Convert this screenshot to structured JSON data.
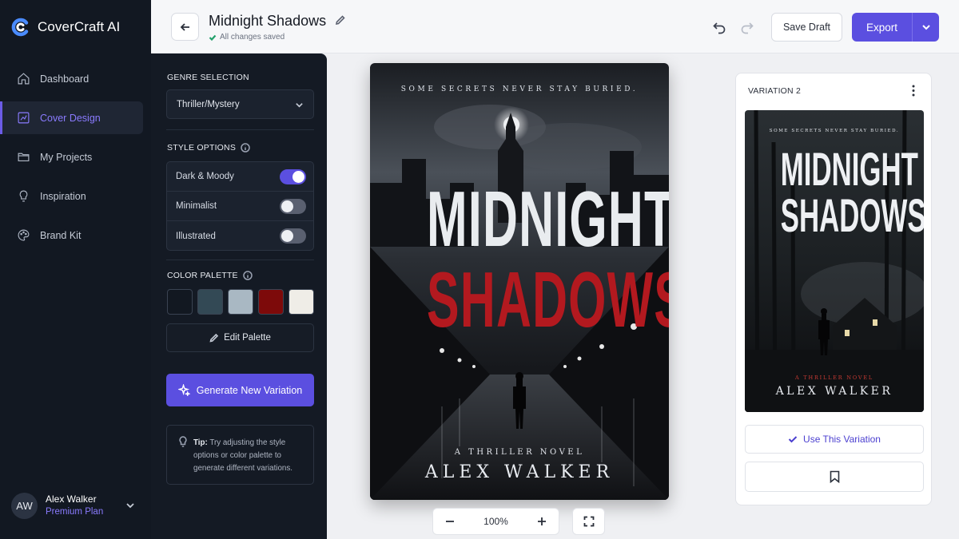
{
  "app": {
    "name": "CoverCraft AI"
  },
  "sidebar": {
    "items": [
      {
        "label": "Dashboard",
        "icon": "home-icon"
      },
      {
        "label": "Cover Design",
        "icon": "design-icon",
        "active": true
      },
      {
        "label": "My Projects",
        "icon": "folder-icon"
      },
      {
        "label": "Inspiration",
        "icon": "lightbulb-icon"
      },
      {
        "label": "Brand Kit",
        "icon": "palette-icon"
      }
    ],
    "user": {
      "initials": "AW",
      "name": "Alex Walker",
      "plan": "Premium Plan"
    }
  },
  "header": {
    "title": "Midnight Shadows",
    "status": "All changes saved",
    "save_draft": "Save Draft",
    "export": "Export"
  },
  "panel": {
    "genre_label": "GENRE SELECTION",
    "genre_value": "Thriller/Mystery",
    "style_label": "STYLE OPTIONS",
    "styles": [
      {
        "label": "Dark & Moody",
        "on": true
      },
      {
        "label": "Minimalist",
        "on": false
      },
      {
        "label": "Illustrated",
        "on": false
      }
    ],
    "palette_label": "COLOR PALETTE",
    "palette": [
      "#121821",
      "#334955",
      "#a9b8c3",
      "#7d0a0a",
      "#efede7"
    ],
    "edit_palette": "Edit Palette",
    "generate": "Generate New Variation",
    "tip_bold": "Tip:",
    "tip_text": " Try adjusting the style options or color palette to generate different variations."
  },
  "cover": {
    "tagline": "SOME SECRETS NEVER STAY BURIED.",
    "title_line1": "MIDNIGHT",
    "title_line2": "SHADOWS",
    "subtitle": "A THRILLER NOVEL",
    "author": "ALEX WALKER",
    "title_color_1": "#e9ecef",
    "title_color_2": "#b3191f"
  },
  "zoom": {
    "level": "100%"
  },
  "variation": {
    "label": "VARIATION 2",
    "tagline": "SOME SECRETS NEVER STAY BURIED.",
    "title_line1": "MIDNIGHT",
    "title_line2": "SHADOWS",
    "subtitle": "A THRILLER NOVEL",
    "author": "ALEX WALKER",
    "use_label": "Use This Variation"
  },
  "colors": {
    "accent": "#5b4fe0",
    "sidebar_bg": "#121822",
    "panel_bg": "#141a24"
  }
}
